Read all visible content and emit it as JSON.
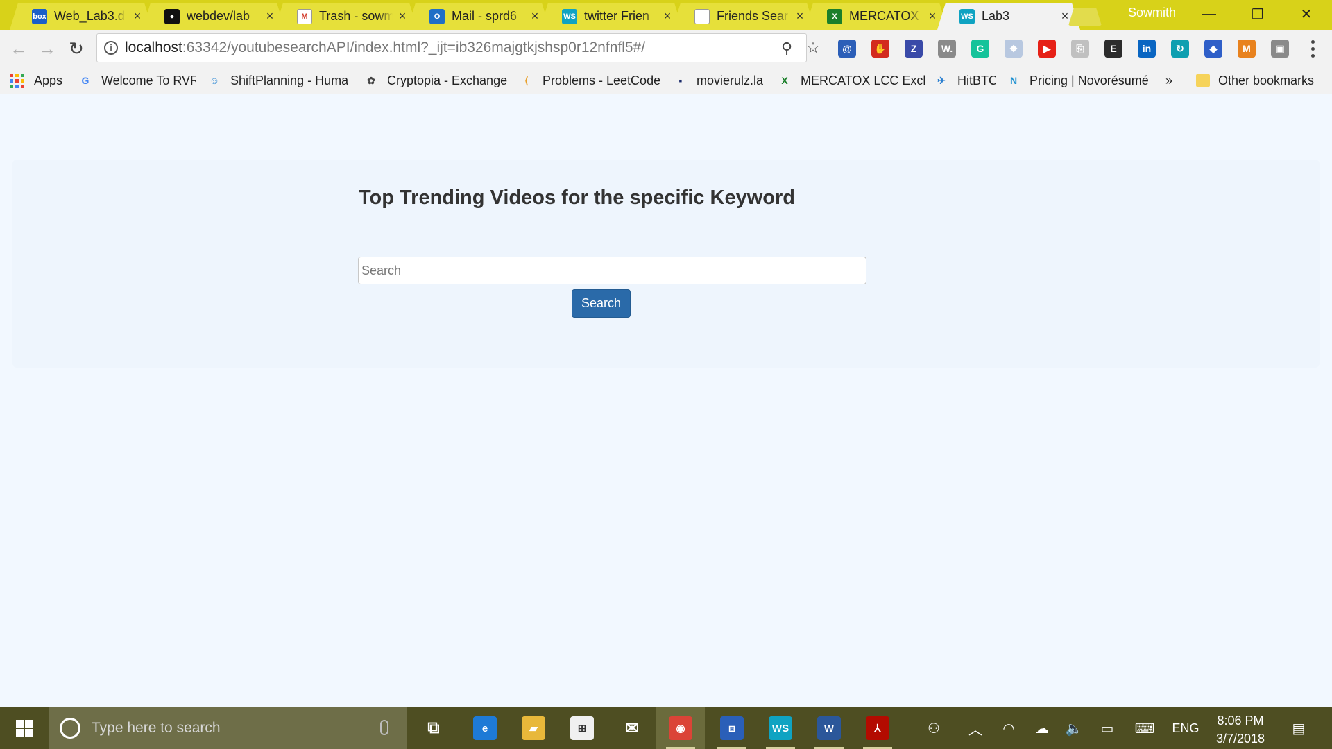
{
  "browser": {
    "tabs": [
      {
        "title": "Web_Lab3.d",
        "favicon_text": "box",
        "favicon_color": "#1a5fc8"
      },
      {
        "title": "webdev/lab",
        "favicon_text": "●",
        "favicon_color": "#111111"
      },
      {
        "title": "Trash - sowm",
        "favicon_text": "M",
        "favicon_color": "#ffffff"
      },
      {
        "title": "Mail - sprd6",
        "favicon_text": "O",
        "favicon_color": "#1f6fc6"
      },
      {
        "title": "twitter Frien",
        "favicon_text": "WS",
        "favicon_color": "#0fa3c2"
      },
      {
        "title": "Friends Sear",
        "favicon_text": "",
        "favicon_color": "#ffffff"
      },
      {
        "title": "MERCATOX",
        "favicon_text": "X",
        "favicon_color": "#1b7f2a"
      },
      {
        "title": "Lab3",
        "favicon_text": "WS",
        "favicon_color": "#0fa3c2",
        "active": true
      }
    ],
    "close_glyph": "×",
    "profile_name": "Sowmith",
    "window_controls": {
      "minimize": "—",
      "restore": "❐",
      "close": "✕"
    },
    "nav": {
      "back": "←",
      "forward": "→",
      "reload": "↻"
    },
    "url": {
      "host": "localhost",
      "rest": ":63342/youtubesearchAPI/index.html?_ijt=ib326majgtkjshsp0r12nfnfl5#/"
    },
    "omnibox_icons": {
      "zoom": "⚲",
      "bookmark_star": "☆",
      "info": "i"
    },
    "extensions": [
      {
        "name": "a-icon",
        "glyph": "@",
        "color": "#2c5fb8"
      },
      {
        "name": "adblock-icon",
        "glyph": "✋",
        "color": "#d32a1e"
      },
      {
        "name": "zotero-icon",
        "glyph": "Z",
        "color": "#3a4aa8"
      },
      {
        "name": "wordtune-icon",
        "glyph": "W.",
        "color": "#8a8a8a"
      },
      {
        "name": "grammarly-icon",
        "glyph": "G",
        "color": "#15c39a"
      },
      {
        "name": "dropbox-icon",
        "glyph": "❖",
        "color": "#b8c8e0"
      },
      {
        "name": "youtube-icon",
        "glyph": "▶",
        "color": "#e62117"
      },
      {
        "name": "pdf-icon",
        "glyph": "⎘",
        "color": "#c0c0c0"
      },
      {
        "name": "evernote-icon",
        "glyph": "E",
        "color": "#2c2c2c"
      },
      {
        "name": "linkedin-icon",
        "glyph": "in",
        "color": "#0a66c2"
      },
      {
        "name": "refresh-ext-icon",
        "glyph": "↻",
        "color": "#0e9fb0"
      },
      {
        "name": "ethereum-icon",
        "glyph": "◆",
        "color": "#2f5fc8"
      },
      {
        "name": "metamask-icon",
        "glyph": "M",
        "color": "#e8821e"
      },
      {
        "name": "chat-ext-icon",
        "glyph": "▣",
        "color": "#8a8a8a"
      }
    ],
    "bookmarks": [
      {
        "label": "Apps"
      },
      {
        "label": "Welcome To RVR",
        "icon": "G",
        "color": "#4285f4"
      },
      {
        "label": "ShiftPlanning - Huma",
        "icon": "☺",
        "color": "#3a8fd6"
      },
      {
        "label": "Cryptopia - Exchange",
        "icon": "✿",
        "color": "#444444"
      },
      {
        "label": "Problems - LeetCode",
        "icon": "⟨",
        "color": "#e8a02c"
      },
      {
        "label": "movierulz.la",
        "icon": "▪",
        "color": "#1a2a6a"
      },
      {
        "label": "MERCATOX LCC Exch",
        "icon": "X",
        "color": "#1b7f2a"
      },
      {
        "label": "HitBTC",
        "icon": "✈",
        "color": "#2a7fd0"
      },
      {
        "label": "Pricing | Novorésumé",
        "icon": "N",
        "color": "#1a8fd0"
      }
    ],
    "bookmarks_overflow": "»",
    "other_bookmarks": "Other bookmarks"
  },
  "page": {
    "title": "Top Trending Videos for the specific Keyword",
    "search_placeholder": "Search",
    "search_value": "",
    "search_button": "Search"
  },
  "taskbar": {
    "search_placeholder": "Type here to search",
    "apps": [
      {
        "name": "task-view-icon",
        "glyph": "⧉",
        "color": "transparent"
      },
      {
        "name": "edge-icon",
        "glyph": "e",
        "color": "#1e7ad6"
      },
      {
        "name": "file-explorer-icon",
        "glyph": "▰",
        "color": "#e8b83a"
      },
      {
        "name": "store-icon",
        "glyph": "⊞",
        "color": "#f0f0f0"
      },
      {
        "name": "mail-icon",
        "glyph": "✉",
        "color": "transparent"
      },
      {
        "name": "chrome-icon",
        "glyph": "◉",
        "color": "#db4437"
      },
      {
        "name": "network-app-icon",
        "glyph": "⧈",
        "color": "#2a5fb8"
      },
      {
        "name": "webstorm-icon",
        "glyph": "WS",
        "color": "#0fa3c2"
      },
      {
        "name": "word-icon",
        "glyph": "W",
        "color": "#2b579a"
      },
      {
        "name": "acrobat-icon",
        "glyph": "⅄",
        "color": "#b30b00"
      }
    ],
    "tray": {
      "people": "⚇",
      "chevron": "︿",
      "wifi": "◠",
      "onedrive": "☁",
      "volume": "🔈",
      "battery": "▭",
      "keyboard": "⌨",
      "language": "ENG",
      "notifications": "▤"
    },
    "time": "8:06 PM",
    "date": "3/7/2018"
  }
}
